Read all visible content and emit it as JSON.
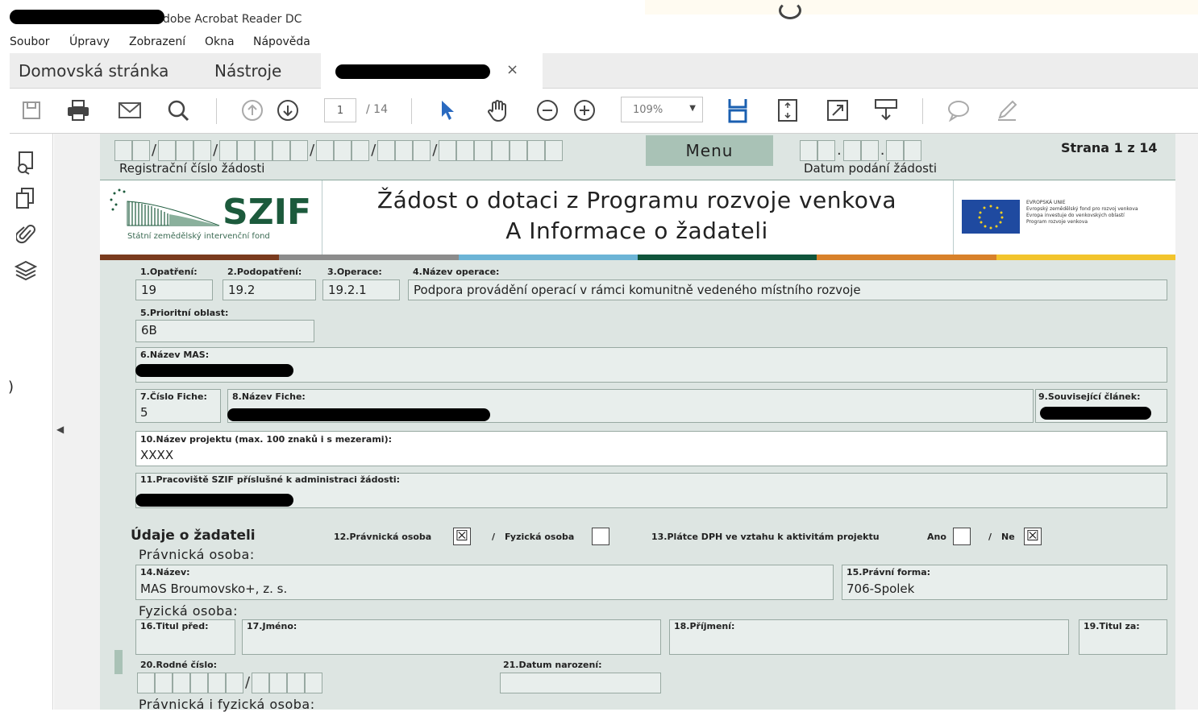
{
  "window": {
    "title": "dobe Acrobat Reader DC"
  },
  "menubar": {
    "items": [
      "Soubor",
      "Úpravy",
      "Zobrazení",
      "Okna",
      "Nápověda"
    ]
  },
  "tabs": {
    "home": "Domovská stránka",
    "tools": "Nástroje",
    "close": "×"
  },
  "toolbar": {
    "page_current": "1",
    "page_total": "/ 14",
    "zoom": "109%",
    "icons": [
      "save-icon",
      "print-icon",
      "mail-icon",
      "search-icon",
      "page-up-icon",
      "page-down-icon",
      "select-cursor-icon",
      "hand-icon",
      "zoom-out-icon",
      "zoom-in-icon",
      "scroll-mode-icon",
      "fit-page-icon",
      "fullscreen-icon",
      "read-mode-icon",
      "comment-icon",
      "sign-icon"
    ]
  },
  "header": {
    "reg_label": "Registrační číslo žádosti",
    "menu_button": "Menu",
    "date_label": "Datum podání žádosti",
    "page_indicator": "Strana 1 z 14"
  },
  "logo": {
    "name": "SZIF",
    "subtitle": "Státní zemědělský intervenční fond"
  },
  "title": {
    "line1": "Žádost o dotaci z Programu rozvoje venkova",
    "line2": "A Informace o žadateli"
  },
  "eu": {
    "text1": "EVROPSKÁ UNIE",
    "text2": "Evropský zemědělský fond pro rozvoj venkova",
    "text3": "Evropa investuje do venkovských oblastí",
    "text4": "Program rozvoje venkova"
  },
  "stripe_colors": [
    "#7a3b1e",
    "#8c8c8c",
    "#6cb4d6",
    "#10553b",
    "#d8812a",
    "#f2c42c"
  ],
  "form": {
    "f1_label": "1.Opatření:",
    "f1_value": "19",
    "f2_label": "2.Podopatření:",
    "f2_value": "19.2",
    "f3_label": "3.Operace:",
    "f3_value": "19.2.1",
    "f4_label": "4.Název operace:",
    "f4_value": "Podpora provádění operací v rámci komunitně vedeného místního rozvoje",
    "f5_label": "5.Prioritní oblast:",
    "f5_value": "6B",
    "f6_label": "6.Název MAS:",
    "f7_label": "7.Číslo Fiche:",
    "f7_value": "5",
    "f8_label": "8.Název Fiche:",
    "f9_label": "9.Související článek:",
    "f10_label": "10.Název projektu (max. 100 znaků i s mezerami):",
    "f10_value": "XXXX",
    "f11_label": "11.Pracoviště SZIF příslušné k administraci žádosti:",
    "section_applicant": "Údaje o žadateli",
    "f12_label": "12.Právnická osoba",
    "f12_sep": "/",
    "f12_physical": "Fyzická osoba",
    "f12_legal_checked": "☒",
    "f13_label": "13.Plátce DPH ve vztahu k aktivitám projektu",
    "f13_yes": "Ano",
    "f13_sep": "/",
    "f13_no": "Ne",
    "f13_no_checked": "☒",
    "sub_legal": "Právnická osoba:",
    "f14_label": "14.Název:",
    "f14_value": "MAS Broumovsko+, z. s.",
    "f15_label": "15.Právní forma:",
    "f15_value": "706-Spolek",
    "sub_physical": "Fyzická osoba:",
    "f16_label": "16.Titul před:",
    "f17_label": "17.Jméno:",
    "f18_label": "18.Příjmení:",
    "f19_label": "19.Titul za:",
    "f20_label": "20.Rodné číslo:",
    "f20_sep": "/",
    "f21_label": "21.Datum narození:",
    "sub_both": "Právnická i fyzická osoba:"
  }
}
